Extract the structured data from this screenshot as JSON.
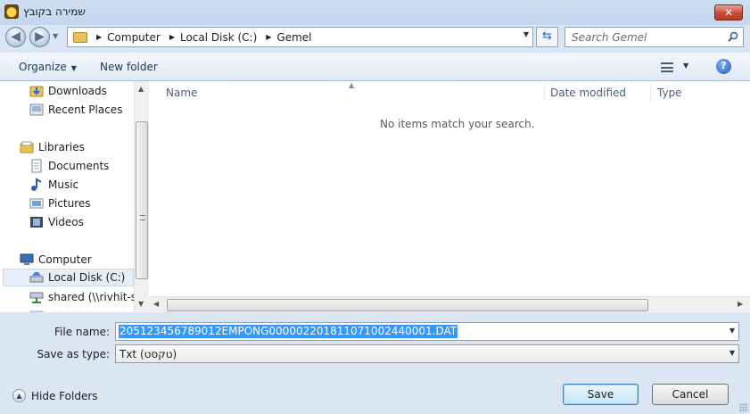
{
  "window": {
    "title": "שמירה בקובץ",
    "close_label": "✕"
  },
  "address": {
    "crumbs": [
      "Computer",
      "Local Disk (C:)",
      "Gemel"
    ],
    "search_placeholder": "Search Gemel"
  },
  "toolbar": {
    "organize_label": "Organize",
    "new_folder_label": "New folder",
    "help_label": "?"
  },
  "nav_pane": {
    "items": [
      {
        "label": "Downloads",
        "icon": "downloads-icon"
      },
      {
        "label": "Recent Places",
        "icon": "recent-places-icon"
      },
      {
        "label": "Libraries",
        "icon": "libraries-icon"
      },
      {
        "label": "Documents",
        "icon": "documents-icon"
      },
      {
        "label": "Music",
        "icon": "music-icon"
      },
      {
        "label": "Pictures",
        "icon": "pictures-icon"
      },
      {
        "label": "Videos",
        "icon": "videos-icon"
      },
      {
        "label": "Computer",
        "icon": "computer-icon"
      },
      {
        "label": "Local Disk (C:)",
        "icon": "local-disk-icon",
        "selected": true
      },
      {
        "label": "shared (\\\\rivhit-se",
        "icon": "network-drive-icon"
      }
    ]
  },
  "file_list": {
    "columns": [
      "Name",
      "Date modified",
      "Type"
    ],
    "empty_message": "No items match your search."
  },
  "form": {
    "file_name_label": "File name:",
    "file_name_value": "205123456789012EMPONG00000220181107100244000​1.DAT",
    "save_as_type_label": "Save as type:",
    "save_as_type_value": "Txt  (טקסט)"
  },
  "footer": {
    "hide_folders_label": "Hide Folders",
    "save_label": "Save",
    "cancel_label": "Cancel"
  },
  "colors": {
    "selection": "#3399ff",
    "title_bar": "#cfdff2",
    "close_button": "#c74a33"
  }
}
